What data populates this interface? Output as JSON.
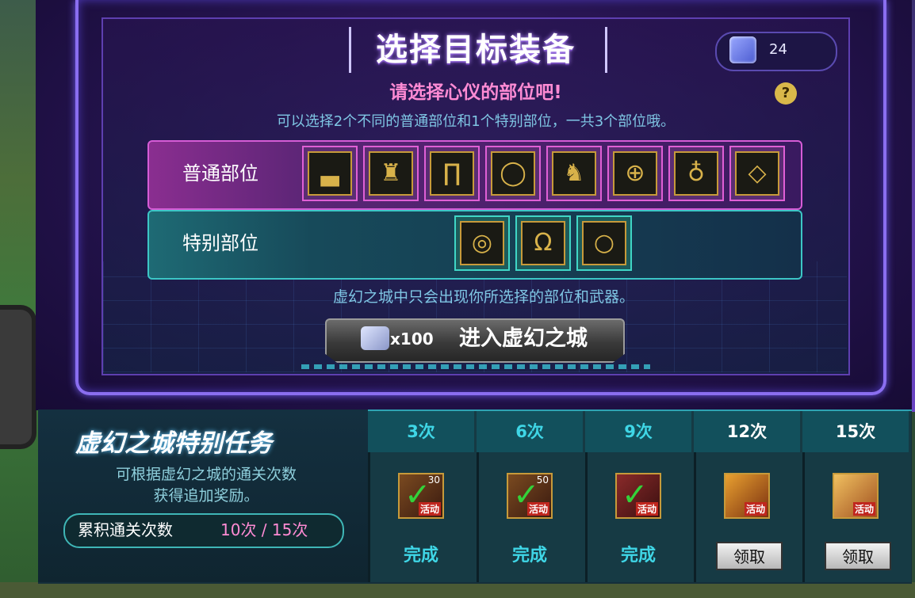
{
  "header": {
    "title": "选择目标装备",
    "currency_value": "24",
    "subtitle": "请选择心仪的部位吧!",
    "instruction": "可以选择2个不同的普通部位和1个特别部位，一共3个部位哦。",
    "help_label": "?"
  },
  "normal_parts": {
    "label": "普通部位",
    "slots": [
      "shoulder",
      "top",
      "pants",
      "belt",
      "shoes",
      "bracelet",
      "earring",
      "gem"
    ]
  },
  "special_parts": {
    "label": "特别部位",
    "slots": [
      "bracelet",
      "necklace",
      "ring"
    ]
  },
  "note": "虚幻之城中只会出现你所选择的部位和武器。",
  "enter_button": {
    "cost": "x100",
    "label": "进入虚幻之城"
  },
  "mission": {
    "title": "虚幻之城特别任务",
    "desc_line1": "可根据虚幻之城的通关次数",
    "desc_line2": "获得追加奖励。",
    "count_label": "累积通关次数",
    "count_value": "10次 / 15次"
  },
  "rewards": [
    {
      "threshold": "3次",
      "status": "完成",
      "badge": "30",
      "tag": "活动"
    },
    {
      "threshold": "6次",
      "status": "完成",
      "badge": "50",
      "tag": "活动"
    },
    {
      "threshold": "9次",
      "status": "完成",
      "badge": "",
      "tag": "活动"
    },
    {
      "threshold": "12次",
      "action": "领取",
      "tag": "活动"
    },
    {
      "threshold": "15次",
      "action": "领取",
      "tag": "活动"
    }
  ],
  "colors": {
    "accent_pink": "#ff8bd4",
    "accent_cyan": "#3fd6e6",
    "gold": "#c79a3a",
    "done_check": "#33d23a"
  }
}
